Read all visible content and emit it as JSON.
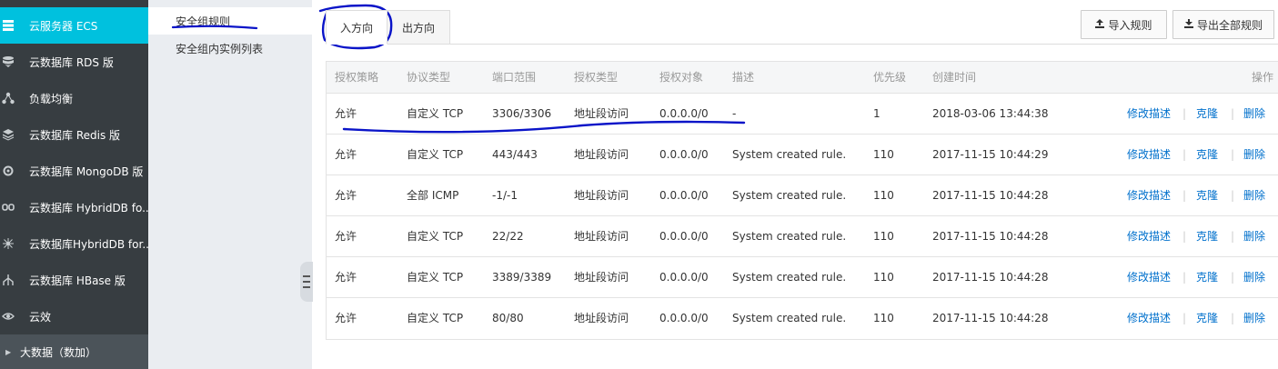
{
  "sidebar": {
    "items": [
      {
        "label": "云服务器 ECS",
        "icon": "server-icon"
      },
      {
        "label": "云数据库 RDS 版",
        "icon": "database-icon"
      },
      {
        "label": "负载均衡",
        "icon": "network-icon"
      },
      {
        "label": "云数据库 Redis 版",
        "icon": "stack-icon"
      },
      {
        "label": "云数据库 MongoDB 版",
        "icon": "gear-icon"
      },
      {
        "label": "云数据库 HybridDB fo...",
        "icon": "link-icon"
      },
      {
        "label": "云数据库HybridDB for...",
        "icon": "hub-icon"
      },
      {
        "label": "云数据库 HBase 版",
        "icon": "tree-icon"
      },
      {
        "label": "云效",
        "icon": "eye-icon"
      }
    ],
    "group": {
      "label": "大数据（数加）"
    },
    "accent_color": "#00c1de"
  },
  "subnav": {
    "items": [
      {
        "label": "安全组规则"
      },
      {
        "label": "安全组内实例列表"
      }
    ]
  },
  "tabs": [
    {
      "label": "入方向"
    },
    {
      "label": "出方向"
    }
  ],
  "toolbar": {
    "import_label": "导入规则",
    "export_label": "导出全部规则"
  },
  "table": {
    "headers": {
      "policy": "授权策略",
      "protocol": "协议类型",
      "port": "端口范围",
      "auth_type": "授权类型",
      "target": "授权对象",
      "desc": "描述",
      "priority": "优先级",
      "created": "创建时间",
      "ops": "操作"
    },
    "actions": {
      "edit": "修改描述",
      "clone": "克隆",
      "delete": "删除",
      "sep": "|"
    },
    "rows": [
      {
        "policy": "允许",
        "protocol": "自定义 TCP",
        "port": "3306/3306",
        "auth_type": "地址段访问",
        "target": "0.0.0.0/0",
        "desc": "-",
        "priority": "1",
        "created": "2018-03-06 13:44:38"
      },
      {
        "policy": "允许",
        "protocol": "自定义 TCP",
        "port": "443/443",
        "auth_type": "地址段访问",
        "target": "0.0.0.0/0",
        "desc": "System created rule.",
        "priority": "110",
        "created": "2017-11-15 10:44:29"
      },
      {
        "policy": "允许",
        "protocol": "全部 ICMP",
        "port": "-1/-1",
        "auth_type": "地址段访问",
        "target": "0.0.0.0/0",
        "desc": "System created rule.",
        "priority": "110",
        "created": "2017-11-15 10:44:28"
      },
      {
        "policy": "允许",
        "protocol": "自定义 TCP",
        "port": "22/22",
        "auth_type": "地址段访问",
        "target": "0.0.0.0/0",
        "desc": "System created rule.",
        "priority": "110",
        "created": "2017-11-15 10:44:28"
      },
      {
        "policy": "允许",
        "protocol": "自定义 TCP",
        "port": "3389/3389",
        "auth_type": "地址段访问",
        "target": "0.0.0.0/0",
        "desc": "System created rule.",
        "priority": "110",
        "created": "2017-11-15 10:44:28"
      },
      {
        "policy": "允许",
        "protocol": "自定义 TCP",
        "port": "80/80",
        "auth_type": "地址段访问",
        "target": "0.0.0.0/0",
        "desc": "System created rule.",
        "priority": "110",
        "created": "2017-11-15 10:44:28"
      }
    ]
  },
  "annotation_color": "#0a14c8"
}
